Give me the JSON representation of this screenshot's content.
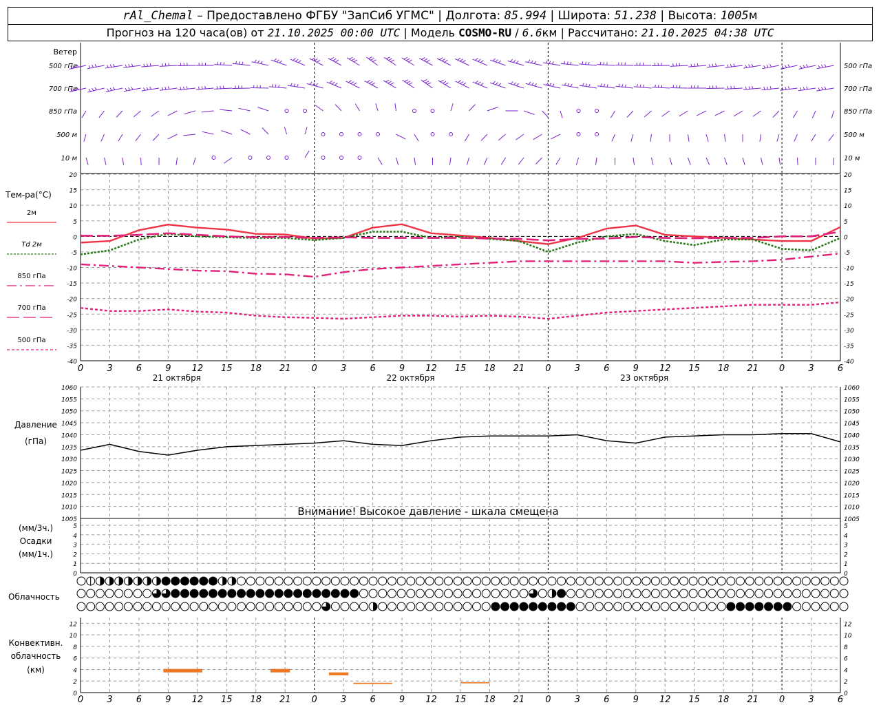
{
  "header": {
    "station": "rAl_Chemal",
    "provider": "Предоставлено ФГБУ \"ЗапСиб УГМС\"",
    "lon_label": "Долгота:",
    "lon": "85.994",
    "lat_label": "Широта:",
    "lat": "51.238",
    "alt_label": "Высота:",
    "alt": "1005",
    "alt_unit": "м",
    "forecast_prefix": "Прогноз на 120 часа(ов) от",
    "forecast_start": "21.10.2025 00:00 UTC",
    "model_label": "Модель",
    "model": "COSMO-RU",
    "model_res": "6.6",
    "model_res_unit": "км",
    "calc_label": "Рассчитано:",
    "calc_time": "21.10.2025 04:38 UTC"
  },
  "time_axis": {
    "hour_labels": [
      "0",
      "3",
      "6",
      "9",
      "12",
      "15",
      "18",
      "21",
      "0",
      "3",
      "6",
      "9",
      "12",
      "15",
      "18",
      "21",
      "0",
      "3",
      "6",
      "9",
      "12",
      "15",
      "18",
      "21",
      "0",
      "3",
      "6"
    ],
    "day_labels": [
      "21 октября",
      "22 октября",
      "23 октября"
    ]
  },
  "wind_panel": {
    "title": "Ветер",
    "levels": [
      "500 гПа",
      "700 гПа",
      "850 гПа",
      "500 м",
      "10 м"
    ]
  },
  "chart_data": [
    {
      "type": "line",
      "panel": "temperature",
      "title": "Тем-ра(°C)",
      "x_hours": [
        0,
        3,
        6,
        9,
        12,
        15,
        18,
        21,
        24,
        27,
        30,
        33,
        36,
        39,
        42,
        45,
        48,
        51,
        54,
        57,
        60,
        63,
        66,
        69,
        72,
        75,
        78
      ],
      "ylim": [
        -40,
        20
      ],
      "yticks": [
        -40,
        -35,
        -30,
        -25,
        -20,
        -15,
        -10,
        -5,
        0,
        5,
        10,
        15,
        20
      ],
      "grid": true,
      "series": [
        {
          "name": "2м",
          "color": "#ee3344",
          "style": "solid",
          "values": [
            -2,
            -1.5,
            2,
            3.8,
            2.8,
            2.2,
            0.8,
            0.6,
            -0.7,
            -0.5,
            2.8,
            3.9,
            1,
            0.3,
            -0.5,
            -1.5,
            -2.5,
            -0.5,
            2.5,
            3.5,
            0.5,
            0,
            -0.5,
            -1,
            -1.5,
            -1.5,
            3
          ]
        },
        {
          "name": "Td 2м",
          "color": "#2a7a1a",
          "style": "dotted",
          "values": [
            -5.8,
            -4.5,
            -1,
            0.8,
            0,
            -0.3,
            -0.5,
            -0.5,
            -1.2,
            -0.5,
            1.5,
            1.5,
            -0.5,
            -0.2,
            -0.8,
            -1.5,
            -5,
            -2,
            0,
            0.8,
            -1.5,
            -2.8,
            -1,
            -1,
            -4,
            -4.5,
            -0.5
          ]
        },
        {
          "name": "850 гПа",
          "color": "#e0207a",
          "style": "dashdot",
          "values": [
            -9,
            -9.5,
            -10,
            -10.5,
            -11,
            -11.2,
            -12,
            -12.2,
            -13,
            -11.5,
            -10.5,
            -10,
            -9.5,
            -9,
            -8.5,
            -8,
            -8,
            -8,
            -8,
            -8,
            -8,
            -8.5,
            -8.2,
            -8,
            -7.5,
            -6.5,
            -5.5
          ]
        },
        {
          "name": "700 гПа",
          "color": "#e0207a",
          "style": "longdash",
          "values": [
            0.2,
            0.2,
            0.5,
            1,
            0.5,
            0,
            -0.3,
            -0.2,
            -0.5,
            -0.3,
            -0.5,
            -0.5,
            -0.5,
            -0.5,
            -0.7,
            -0.8,
            -1.3,
            -0.8,
            -0.7,
            -0.2,
            -0.5,
            -0.6,
            -0.5,
            -0.5,
            0,
            0,
            1.5
          ]
        },
        {
          "name": "500 гПа",
          "color": "#e0207a",
          "style": "shortdash",
          "values": [
            -23,
            -24,
            -24,
            -23.5,
            -24.2,
            -24.5,
            -25.5,
            -26,
            -26.2,
            -26.5,
            -26,
            -25.5,
            -25.5,
            -25.8,
            -25.5,
            -25.8,
            -26.5,
            -25.5,
            -24.5,
            -24,
            -23.5,
            -23,
            -22.5,
            -22,
            -22,
            -22,
            -21.2
          ]
        }
      ]
    },
    {
      "type": "line",
      "panel": "pressure",
      "title": "Давление",
      "ylabel": "(гПа)",
      "x_hours": [
        0,
        3,
        6,
        9,
        12,
        15,
        18,
        21,
        24,
        27,
        30,
        33,
        36,
        39,
        42,
        45,
        48,
        51,
        54,
        57,
        60,
        63,
        66,
        69,
        72,
        75,
        78
      ],
      "ylim": [
        1005,
        1060
      ],
      "yticks": [
        1005,
        1010,
        1015,
        1020,
        1025,
        1030,
        1035,
        1040,
        1045,
        1050,
        1055,
        1060
      ],
      "grid": true,
      "series": [
        {
          "color": "#000000",
          "values": [
            1033.5,
            1036,
            1033,
            1031.5,
            1033.5,
            1035,
            1035.5,
            1036,
            1036.5,
            1037.5,
            1036,
            1035.5,
            1037.5,
            1039,
            1039.5,
            1039.5,
            1039.5,
            1040,
            1037.5,
            1036.5,
            1039,
            1039.5,
            1040,
            1040,
            1040.5,
            1040.5,
            1037
          ]
        }
      ],
      "annotation": "Внимание! Высокое давление - шкала смещена"
    },
    {
      "type": "bar",
      "panel": "precipitation",
      "title": "Осадки",
      "ylabel_left_top": "(мм/3ч.)",
      "ylabel_left_bottom": "(мм/1ч.)",
      "ylim": [
        0,
        5
      ],
      "yticks": [
        0,
        1,
        2,
        3,
        4,
        5
      ],
      "values": []
    },
    {
      "type": "table",
      "panel": "cloudiness",
      "title": "Облачность",
      "rows": [
        {
          "level": "upper",
          "cover": "0244444448888884400000000000000000000000000000000000000000000000000000000000"
        },
        {
          "level": "middle",
          "cover": "0000000066888888888888888888880000000000000000006048000000000000000000000000000"
        },
        {
          "level": "lower",
          "cover": "0000000000000000000000000060000400000000000088888888800000000000000008888888000000000"
        }
      ]
    },
    {
      "type": "bar",
      "panel": "convective",
      "title": "Конвективн.",
      "title2": "облачность",
      "ylabel": "(км)",
      "ylim": [
        0,
        13
      ],
      "yticks": [
        0,
        2,
        4,
        6,
        8,
        10,
        12
      ],
      "bars": [
        {
          "x_start": 8.5,
          "x_end": 12.5,
          "base": 3.5,
          "top": 4.1,
          "color": "#ee7722"
        },
        {
          "x_start": 19.5,
          "x_end": 21.5,
          "base": 3.5,
          "top": 4.1,
          "color": "#ee7722"
        },
        {
          "x_start": 25.5,
          "x_end": 27.5,
          "base": 3.0,
          "top": 3.5,
          "color": "#ee7722"
        },
        {
          "x_start": 28,
          "x_end": 32,
          "base": 1.5,
          "top": 1.7,
          "color": "#ee7722"
        },
        {
          "x_start": 39,
          "x_end": 42,
          "base": 1.6,
          "top": 1.8,
          "color": "#ee7722"
        }
      ]
    }
  ],
  "colors": {
    "wind_barb": "#7722cc",
    "grid": "#999999"
  }
}
